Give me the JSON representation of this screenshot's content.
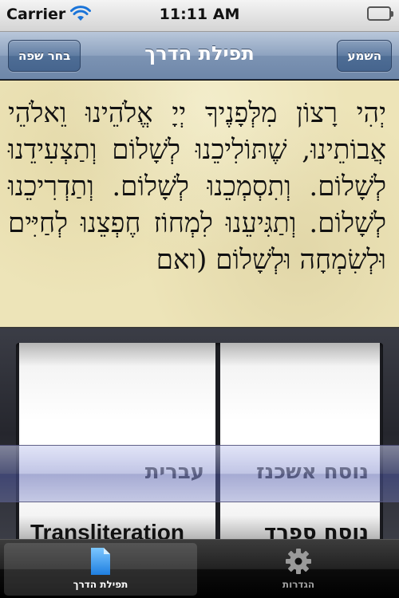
{
  "status_bar": {
    "carrier": "Carrier",
    "time": "11:11 AM"
  },
  "nav": {
    "title": "תפילת הדרך",
    "left_button": "בחר שפה",
    "right_button": "השמע"
  },
  "prayer": {
    "text": "יְהִי רָצוֹן מִלְּפָנֶיךָ יְיָ אֱלֹהֵינוּ וֵאלֹהֵי אֲבוֹתֵינוּ, שֶׁתּוֹלִיכֵנוּ לְשָׁלוֹם וְתַצְעִידֵנוּ לְשָׁלוֹם. וְתִסְמְכֵנוּ לְשָׁלוֹם. וְתַדְרִיכֵנוּ לְשָׁלוֹם. וְתַגִּיעֵנוּ לִמְחוֹז חֶפְצֵנוּ לְחַיִּים וּלְשִׂמְחָה וּלְשָׁלוֹם (ואם"
  },
  "picker": {
    "language_wheel": {
      "selected": "עברית",
      "next": "Transliteration"
    },
    "nusach_wheel": {
      "selected": "נוסח אשכנז",
      "next": "נוסח ספרד"
    }
  },
  "tabs": [
    {
      "label": "תפילת הדרך",
      "icon": "document-icon",
      "active": true
    },
    {
      "label": "הגדרות",
      "icon": "gear-icon",
      "active": false
    }
  ],
  "colors": {
    "nav_bar": "#7c93b3",
    "parchment": "#ede4b8",
    "picker_selection": "#7882c8"
  }
}
